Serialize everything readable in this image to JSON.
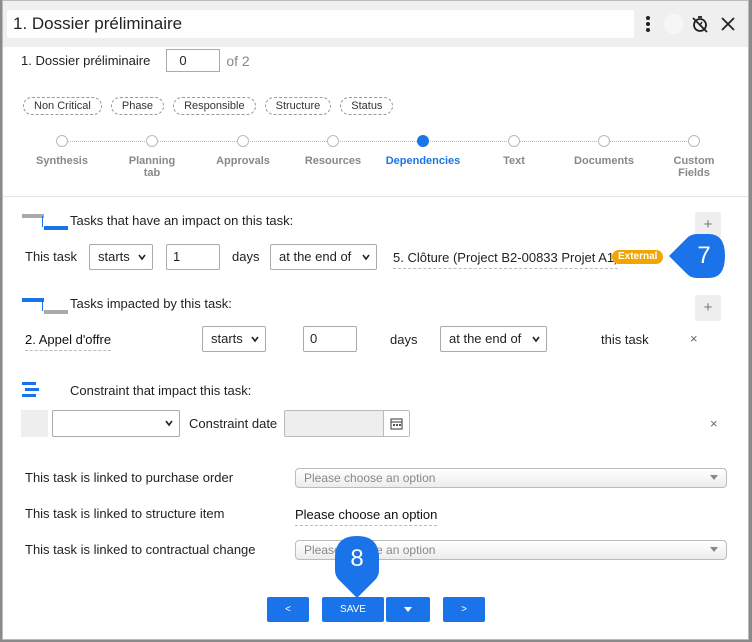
{
  "header": {
    "title": "1. Dossier préliminaire"
  },
  "subheader": {
    "label": "1. Dossier préliminaire",
    "page_value": "0",
    "of_text": "of 2"
  },
  "filters": [
    "Non Critical",
    "Phase",
    "Responsible",
    "Structure",
    "Status"
  ],
  "steps": [
    {
      "label": "Synthesis"
    },
    {
      "label": "Planning tab"
    },
    {
      "label": "Approvals"
    },
    {
      "label": "Resources"
    },
    {
      "label": "Dependencies",
      "active": true
    },
    {
      "label": "Text"
    },
    {
      "label": "Documents"
    },
    {
      "label": "Custom Fields"
    }
  ],
  "impact_section": {
    "title": "Tasks that have an impact on this task:",
    "row": {
      "label": "This task",
      "relation": "starts",
      "days_value": "1",
      "days_label": "days",
      "timing": "at the end of",
      "linked_task": "5. Clôture (Project B2-00833 Projet A1)",
      "badge": "External"
    }
  },
  "impacted_section": {
    "title": "Tasks impacted by this task:",
    "row": {
      "task": "2. Appel d'offre",
      "relation": "starts",
      "days_value": "0",
      "days_label": "days",
      "timing": "at the end of",
      "target": "this task",
      "remove": "×"
    }
  },
  "constraint_section": {
    "title": "Constraint that impact this task:",
    "date_label": "Constraint date",
    "remove": "×"
  },
  "links": {
    "purchase_label": "This task is linked to purchase order",
    "purchase_placeholder": "Please choose an option",
    "structure_label": "This task is linked to structure item",
    "structure_value": "Please choose an option",
    "change_label": "This task is linked to contractual change",
    "change_placeholder": "Please choose an option"
  },
  "footer": {
    "prev": "<",
    "save": "SAVE",
    "next": ">"
  },
  "callouts": {
    "first": "7",
    "second": "8"
  },
  "colors": {
    "accent": "#1a73e8",
    "badge": "#f0a500"
  }
}
